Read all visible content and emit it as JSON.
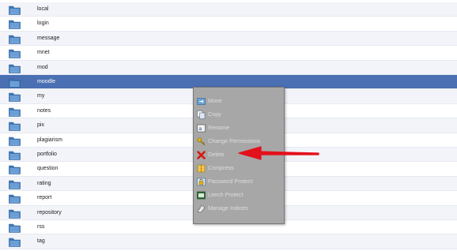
{
  "file_list": {
    "rows": [
      {
        "name": "local"
      },
      {
        "name": "login"
      },
      {
        "name": "message"
      },
      {
        "name": "mnet"
      },
      {
        "name": "mod"
      },
      {
        "name": "moodle",
        "selected": true
      },
      {
        "name": "my"
      },
      {
        "name": "notes"
      },
      {
        "name": "pix"
      },
      {
        "name": "plagiarism"
      },
      {
        "name": "portfolio"
      },
      {
        "name": "question"
      },
      {
        "name": "rating"
      },
      {
        "name": "report"
      },
      {
        "name": "repository"
      },
      {
        "name": "rss"
      },
      {
        "name": "tag"
      }
    ]
  },
  "context_menu": {
    "items": [
      {
        "label": "Move",
        "icon": "move-icon"
      },
      {
        "label": "Copy",
        "icon": "copy-icon"
      },
      {
        "label": "Rename",
        "icon": "rename-icon"
      },
      {
        "label": "Change Permissions",
        "icon": "key-icon"
      },
      {
        "label": "Delete",
        "icon": "delete-icon"
      },
      {
        "label": "Compress",
        "icon": "compress-icon"
      },
      {
        "label": "Password Protect",
        "icon": "password-protect-icon"
      },
      {
        "label": "Leech Protect",
        "icon": "leech-protect-icon"
      },
      {
        "label": "Manage Indices",
        "icon": "manage-indices-icon"
      }
    ]
  },
  "colors": {
    "selected_row": "#4a6fb3",
    "menu_bg": "#a7a7a7",
    "arrow": "#e3111b",
    "folder": "#3e78b8"
  }
}
